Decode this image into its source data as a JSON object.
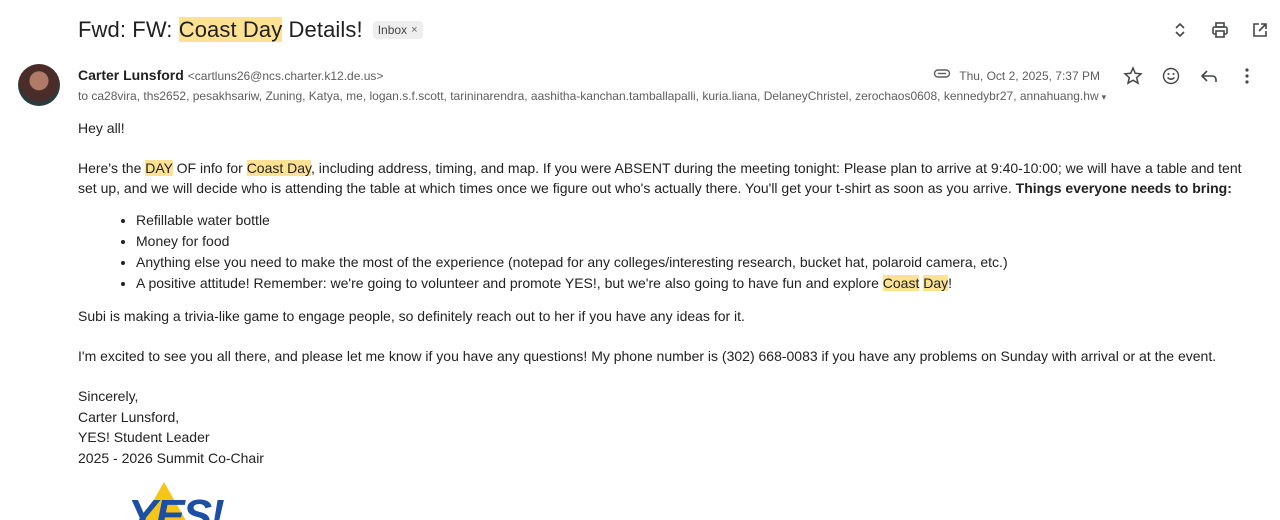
{
  "email": {
    "subject_prefix": "Fwd: FW: ",
    "subject_highlight": "Coast Day",
    "subject_suffix": " Details!",
    "label": "Inbox",
    "label_remove": "×",
    "sender_name": "Carter Lunsford",
    "sender_email": "<cartluns26@ncs.charter.k12.de.us>",
    "date": "Thu, Oct 2, 2025, 7:37 PM",
    "to": "to ca28vira, ths2652, pesakhsariw, Zuning, Katya, me, logan.s.f.scott, tarininarendra, aashitha-kanchan.tamballapalli, kuria.liana, DelaneyChristel, zerochaos0608, kennedybr27, annahuang.hw",
    "to_caret": "▾"
  },
  "icons": {
    "top": [
      "expand-collapse-icon",
      "print-icon",
      "open-new-window-icon"
    ],
    "meta": [
      "attachment-icon",
      "star-icon",
      "emoji-react-icon",
      "reply-icon",
      "more-options-icon"
    ]
  },
  "body": {
    "greeting": "Hey all!",
    "p1_a": "Here's the ",
    "p1_hl1": "DAY",
    "p1_b": " OF info for ",
    "p1_hl2": "Coast Day",
    "p1_c": ", including address, timing, and map. If you were ABSENT during the meeting tonight: Please plan to arrive at 9:40-10:00; we will have a table and tent set up, and we will decide who is attending the table at which times once we figure out who's actually there. You'll get your t-shirt as soon as you arrive. ",
    "p1_bold": "Things everyone needs to bring:",
    "bullets": [
      "Refillable water bottle",
      "Money for food",
      "Anything else you need to make the most of the experience (notepad for any colleges/interesting research, bucket hat, polaroid camera, etc.)"
    ],
    "bullet4_a": "A positive attitude! Remember: we're going to volunteer and promote YES!, but we're also going to have fun and explore ",
    "bullet4_hl1": "Coast",
    "bullet4_hl2": "Day",
    "bullet4_b": "!",
    "p2": "Subi is making a trivia-like game to engage people, so definitely reach out to her if you have any ideas for it.",
    "p3": "I'm excited to see you all there, and please let me know if you have any questions! My phone number is (302) 668-0083 if you have any problems on Sunday with arrival or at the event.",
    "signature": [
      "Sincerely,",
      "Carter Lunsford,",
      "YES! Student Leader",
      "2025 - 2026 Summit Co-Chair"
    ],
    "logo_text": "YES!"
  },
  "colors": {
    "highlight": "#fde293",
    "logo_blue": "#1b4fa3",
    "logo_yellow": "#f5c518"
  }
}
